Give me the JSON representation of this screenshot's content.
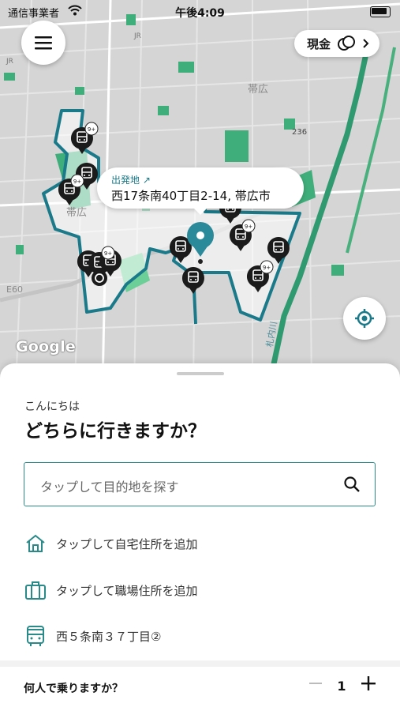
{
  "status_bar": {
    "carrier": "通信事業者",
    "time": "午後4:09"
  },
  "map": {
    "labels": {
      "station_jr": "JR",
      "city": "帯広",
      "area": "帯広",
      "route_236": "236",
      "route_e60": "E60",
      "river": "札内川"
    },
    "pickup": {
      "label": "出発地",
      "address": "西17条南40丁目2-14, 帯広市"
    },
    "badge": "9+",
    "google": "Google",
    "colors": {
      "zone": "#1a7a8a",
      "pin": "#2a8a9a",
      "park": "#3fae7a"
    }
  },
  "payment": {
    "label": "現金"
  },
  "sheet": {
    "greeting": "こんにちは",
    "question": "どちらに行きますか？",
    "search_placeholder": "タップして目的地を探す",
    "shortcuts": [
      {
        "icon": "home-icon",
        "label": "タップして自宅住所を追加"
      },
      {
        "icon": "briefcase-icon",
        "label": "タップして職場住所を追加"
      },
      {
        "icon": "bus-icon",
        "label": "西５条南３７丁目②"
      }
    ],
    "passengers": {
      "label": "何人で乗りますか？",
      "count": "1"
    }
  }
}
